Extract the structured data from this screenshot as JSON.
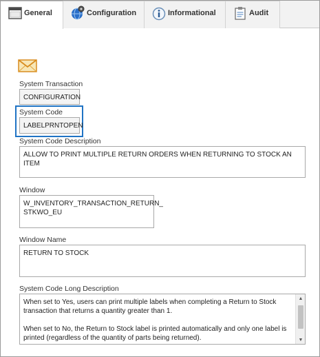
{
  "tabs": [
    {
      "label": "General",
      "icon": "window-icon",
      "active": true
    },
    {
      "label": "Configuration",
      "icon": "gear-globe-icon",
      "active": false
    },
    {
      "label": "Informational",
      "icon": "info-icon",
      "active": false
    },
    {
      "label": "Audit",
      "icon": "clipboard-icon",
      "active": false
    }
  ],
  "fields": {
    "system_transaction": {
      "label": "System Transaction",
      "value": "CONFIGURATION"
    },
    "system_code": {
      "label": "System Code",
      "value": "LABELPRNTOPEN"
    },
    "system_code_description": {
      "label": "System Code Description",
      "value": "ALLOW TO PRINT MULTIPLE RETURN ORDERS WHEN RETURNING TO STOCK AN ITEM"
    },
    "window": {
      "label": "Window",
      "value_line1": "W_INVENTORY_TRANSACTION_RETURN_",
      "value_line2": "STKWO_EU"
    },
    "window_name": {
      "label": "Window Name",
      "value": "RETURN TO STOCK"
    },
    "system_code_long_description": {
      "label": "System Code Long Description",
      "paragraph1": "When set to Yes, users can print multiple labels when completing a Return to Stock transaction that returns a quantity greater than 1.",
      "paragraph2": "When set to No, the Return to Stock label is printed automatically and only one label is printed (regardless of the quantity of parts being returned)."
    }
  },
  "colors": {
    "highlight": "#1f73c4",
    "tab_bg": "#f2f2f2",
    "active_tab_bg": "#ffffff"
  }
}
